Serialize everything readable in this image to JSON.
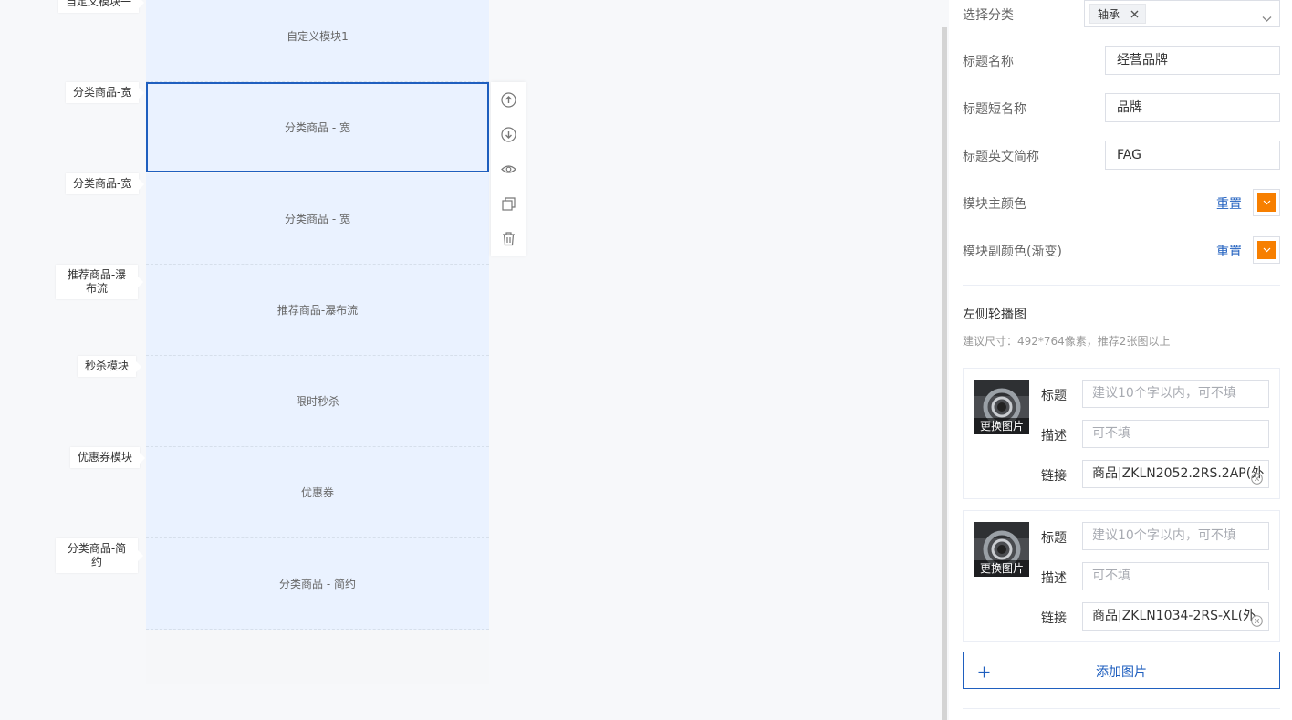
{
  "canvas": {
    "side_tags": [
      "自定义模块一",
      "分类商品-宽",
      "分类商品-宽",
      "推荐商品-瀑布流",
      "秒杀模块",
      "优惠券模块",
      "分类商品-简约"
    ],
    "blocks": [
      "自定义模块1",
      "分类商品 - 宽",
      "分类商品 - 宽",
      "推荐商品-瀑布流",
      "限时秒杀",
      "优惠券",
      "分类商品 - 简约"
    ],
    "toolbar_icons": [
      "move-up-icon",
      "move-down-icon",
      "eye-icon",
      "copy-icon",
      "trash-icon"
    ]
  },
  "panel": {
    "category": {
      "label": "选择分类",
      "selected_tag": "轴承"
    },
    "title_name": {
      "label": "标题名称",
      "value": "经营品牌"
    },
    "title_short": {
      "label": "标题短名称",
      "value": "品牌"
    },
    "title_en": {
      "label": "标题英文简称",
      "value": "FAG"
    },
    "main_color": {
      "label": "模块主颜色",
      "reset": "重置",
      "color": "#f77f00"
    },
    "sub_color": {
      "label": "模块副颜色(渐变)",
      "reset": "重置",
      "color": "#f77f00"
    },
    "carousel": {
      "title": "左侧轮播图",
      "hint": "建议尺寸：492*764像素，推荐2张图以上",
      "change_image": "更换图片",
      "field_title": "标题",
      "field_desc": "描述",
      "field_link": "链接",
      "title_placeholder": "建议10个字以内，可不填",
      "desc_placeholder": "可不填",
      "items": [
        {
          "link": "商品|ZKLN2052.2RS.2AP(外"
        },
        {
          "link": "商品|ZKLN1034-2RS-XL(外"
        }
      ],
      "add_label": "添加图片"
    }
  }
}
